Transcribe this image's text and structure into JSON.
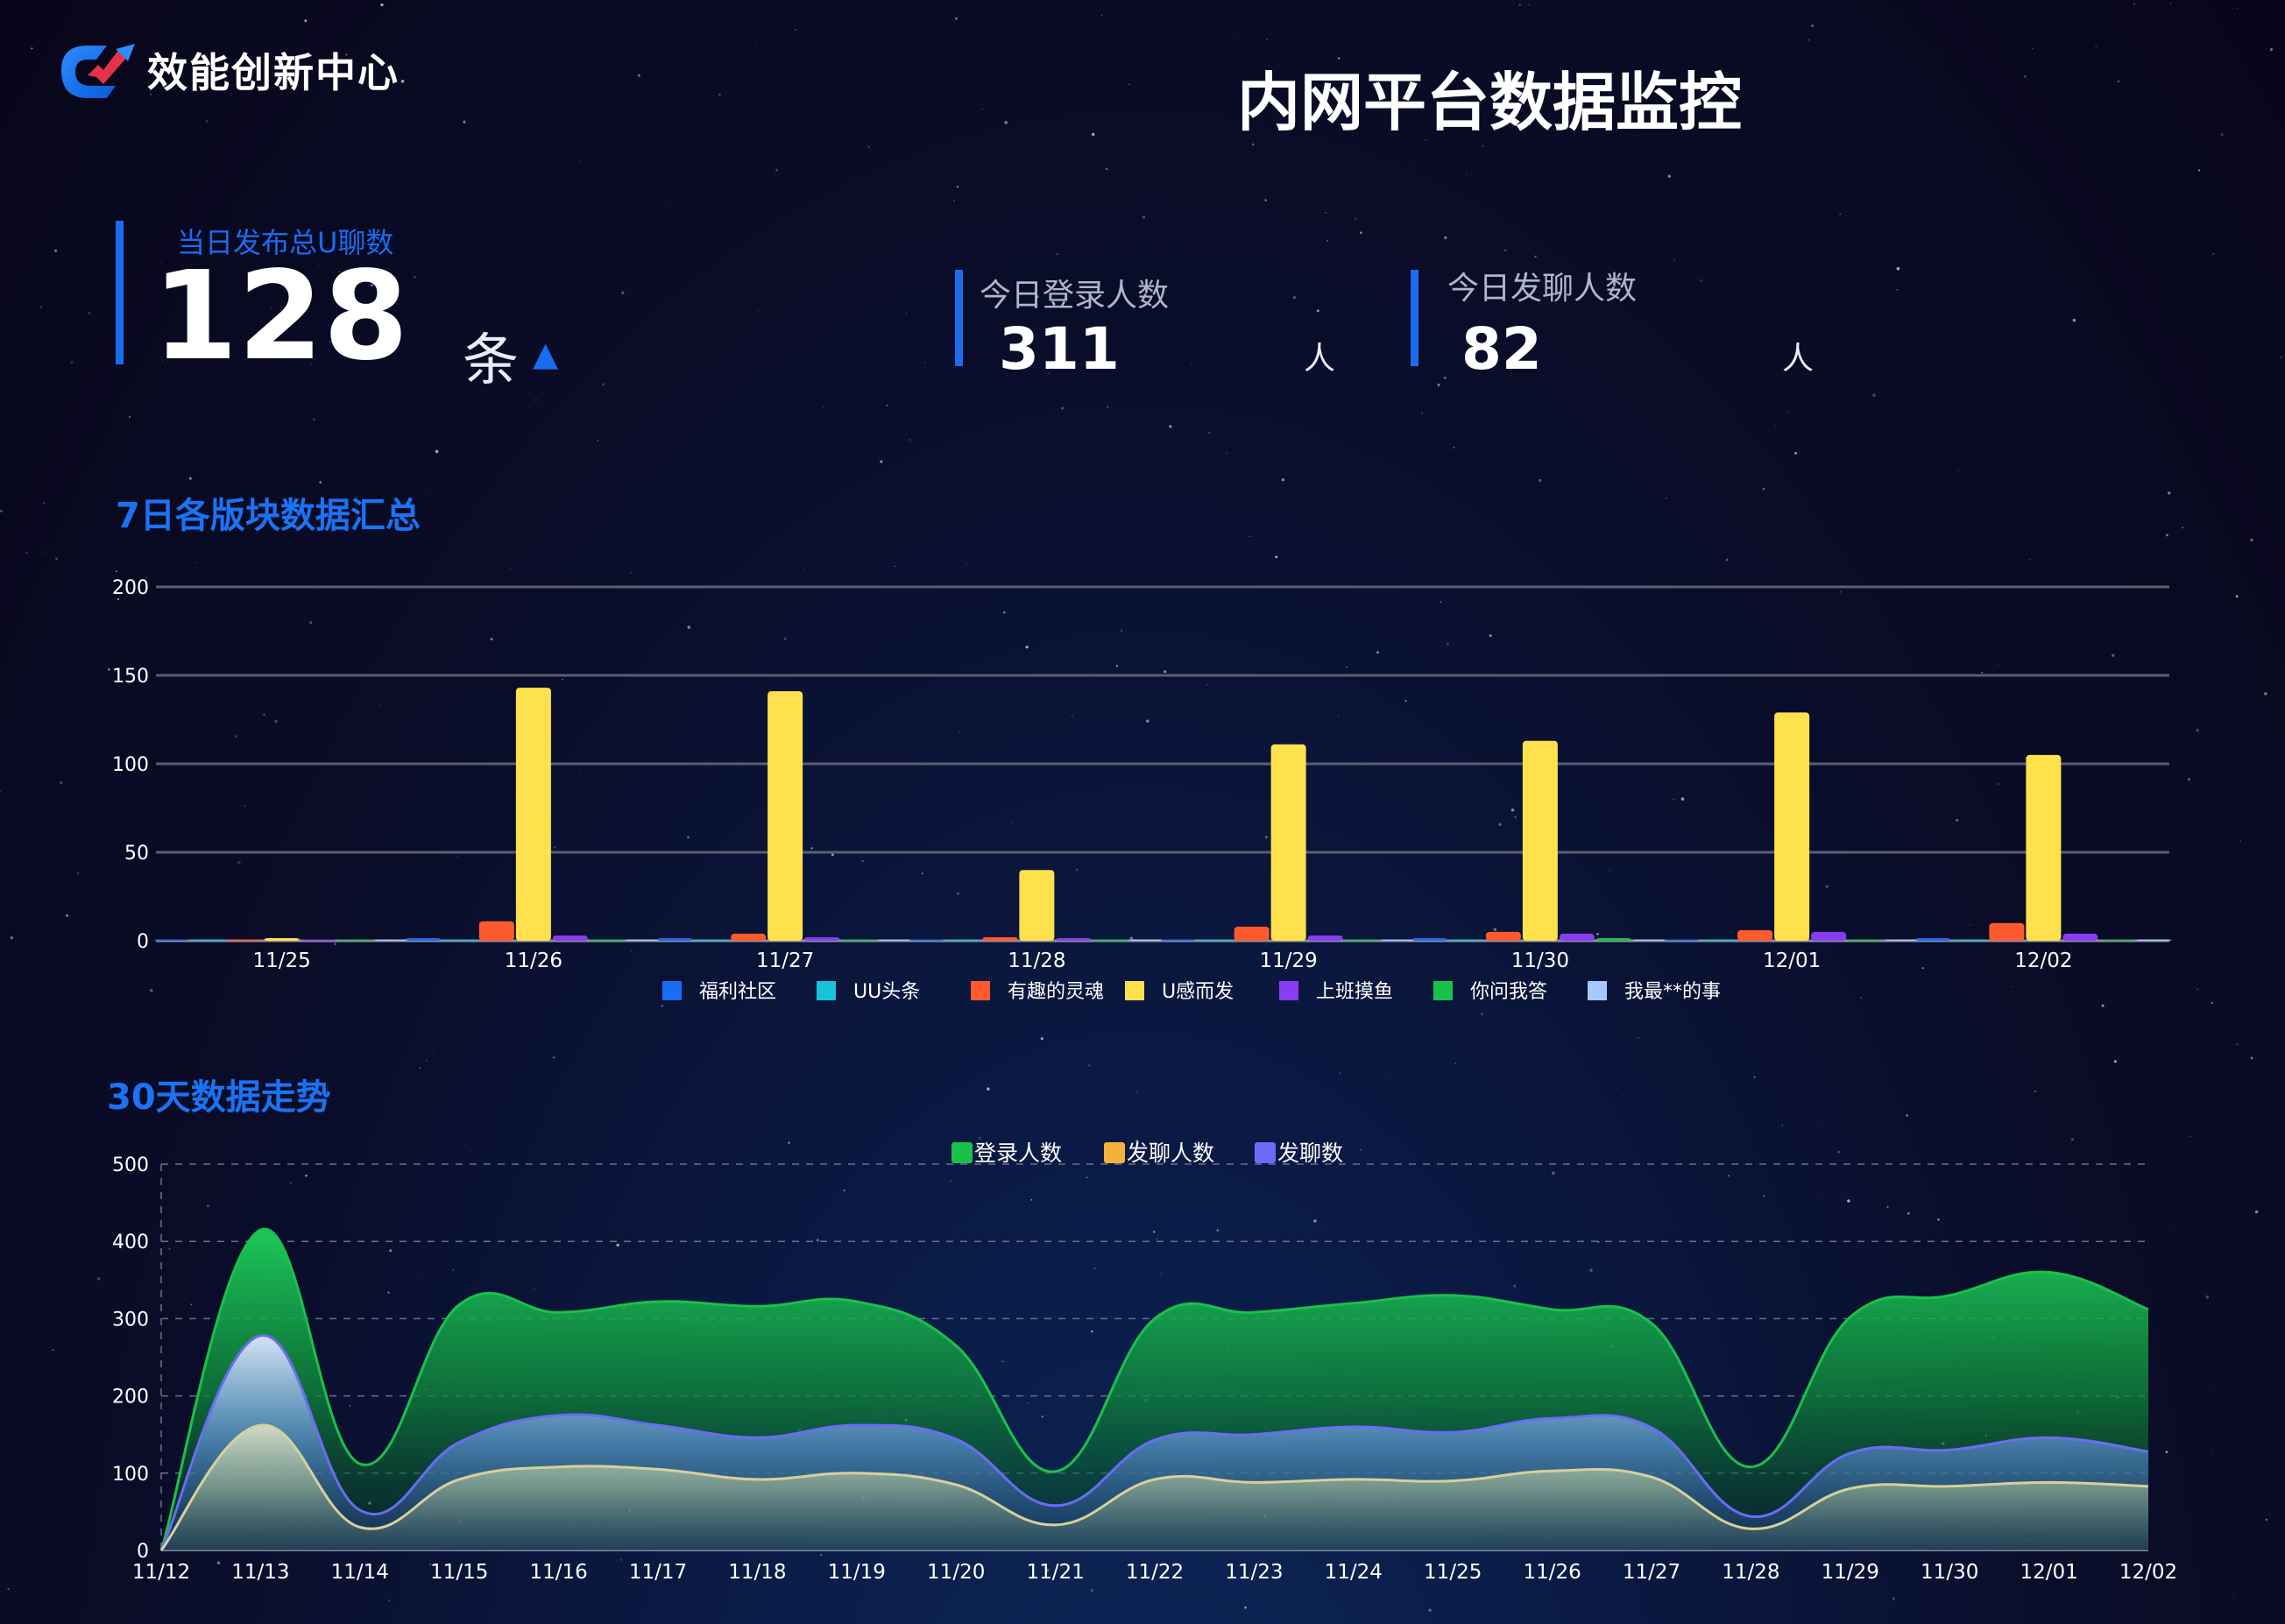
{
  "header": {
    "logo_text": "效能创新中心",
    "title": "内网平台数据监控"
  },
  "kpis": {
    "total_posts": {
      "label": "当日发布总U聊数",
      "value": "128",
      "unit": "条",
      "trend": "▲"
    },
    "logins": {
      "label": "今日登录人数",
      "value": "311",
      "unit": "人"
    },
    "posters": {
      "label": "今日发聊人数",
      "value": "82",
      "unit": "人"
    }
  },
  "sections": {
    "weekly_title": "7日各版块数据汇总",
    "monthly_title": "30天数据走势"
  },
  "colors": {
    "accent": "#1a6cf0",
    "title_blue": "#1a73f5"
  },
  "chart_data": [
    {
      "type": "bar",
      "categories": [
        "11/25",
        "11/26",
        "11/27",
        "11/28",
        "11/29",
        "11/30",
        "12/01",
        "12/02"
      ],
      "ylim": [
        0,
        200
      ],
      "yticks": [
        0,
        50,
        100,
        150,
        200
      ],
      "legend_position": "bottom",
      "series": [
        {
          "name": "福利社区",
          "color": "#1a6cf0",
          "values": [
            0,
            1,
            1,
            0,
            0,
            1,
            0,
            1
          ]
        },
        {
          "name": "UU头条",
          "color": "#16c3d8",
          "values": [
            0,
            0,
            0,
            0,
            0,
            0,
            0,
            0
          ]
        },
        {
          "name": "有趣的灵魂",
          "color": "#ff5a2e",
          "values": [
            0,
            11,
            4,
            2,
            8,
            5,
            6,
            10
          ]
        },
        {
          "name": "U感而发",
          "color": "#ffe14d",
          "values": [
            1,
            143,
            141,
            40,
            111,
            113,
            129,
            105
          ]
        },
        {
          "name": "上班摸鱼",
          "color": "#8a3cf0",
          "values": [
            0,
            3,
            2,
            1,
            3,
            4,
            5,
            4
          ]
        },
        {
          "name": "你问我答",
          "color": "#18c24a",
          "values": [
            0,
            0,
            0,
            0,
            0,
            1,
            0,
            0
          ]
        },
        {
          "name": "我最**的事",
          "color": "#a6c8ff",
          "values": [
            0,
            0,
            0,
            0,
            0,
            0,
            0,
            0
          ]
        }
      ]
    },
    {
      "type": "area",
      "categories": [
        "11/12",
        "11/13",
        "11/14",
        "11/15",
        "11/16",
        "11/17",
        "11/18",
        "11/19",
        "11/20",
        "11/21",
        "11/22",
        "11/23",
        "11/24",
        "11/25",
        "11/26",
        "11/27",
        "11/28",
        "11/29",
        "11/30",
        "12/01",
        "12/02"
      ],
      "ylim": [
        0,
        500
      ],
      "yticks": [
        0,
        100,
        200,
        300,
        400,
        500
      ],
      "legend_position": "top",
      "series": [
        {
          "name": "登录人数",
          "color": "#18c24a",
          "values": [
            0,
            415,
            112,
            318,
            308,
            322,
            316,
            322,
            265,
            102,
            300,
            308,
            320,
            330,
            312,
            294,
            108,
            302,
            330,
            360,
            312
          ]
        },
        {
          "name": "发聊人数",
          "color": "#f5b23b",
          "values": [
            0,
            162,
            30,
            92,
            108,
            105,
            92,
            100,
            85,
            33,
            92,
            88,
            92,
            90,
            103,
            95,
            28,
            80,
            83,
            88,
            83
          ]
        },
        {
          "name": "发聊数",
          "color": "#6b6bf5",
          "values": [
            0,
            278,
            52,
            140,
            175,
            162,
            146,
            162,
            144,
            58,
            143,
            150,
            160,
            153,
            171,
            159,
            44,
            126,
            130,
            146,
            128
          ]
        }
      ]
    }
  ]
}
